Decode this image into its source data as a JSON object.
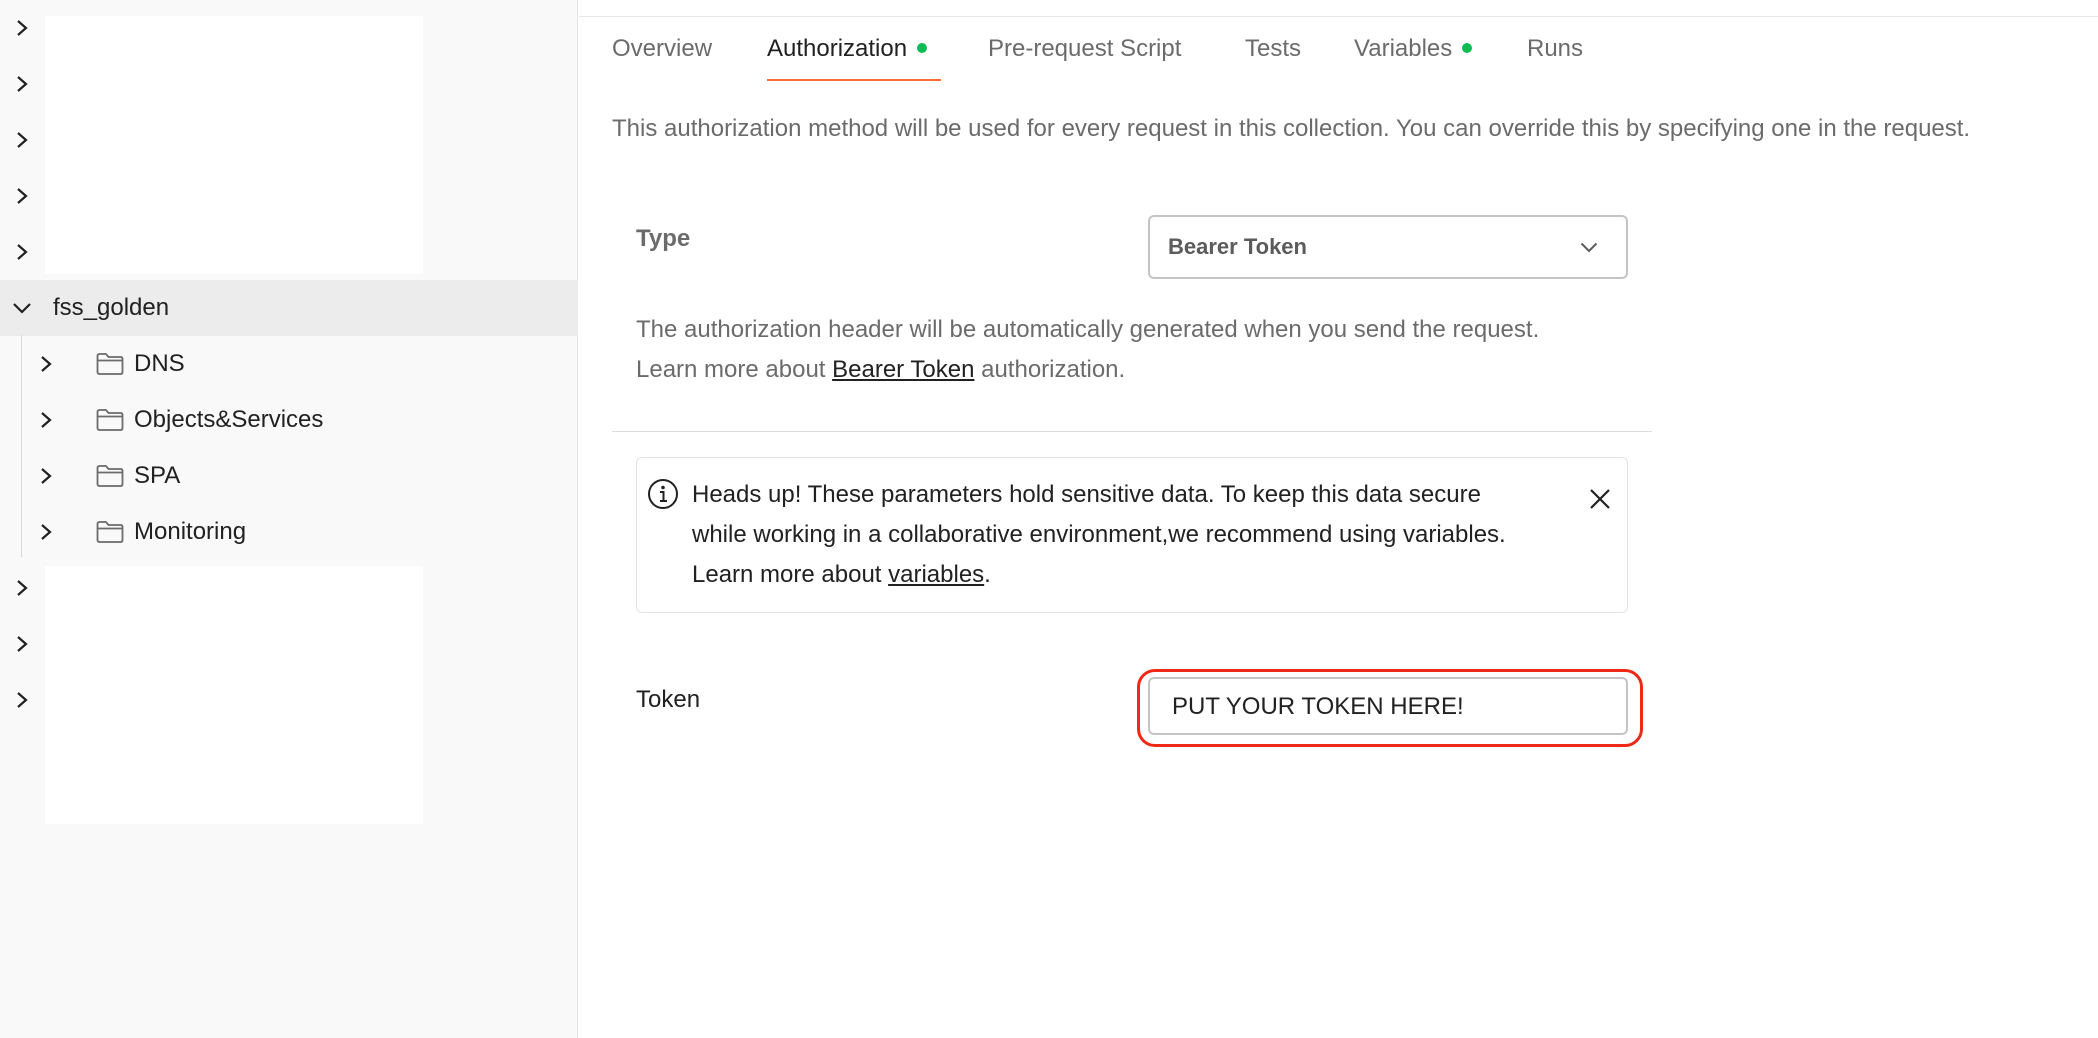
{
  "sidebar": {
    "collection_name": "fss_golden",
    "folders": [
      {
        "label": "DNS"
      },
      {
        "label": "Objects&Services"
      },
      {
        "label": "SPA"
      },
      {
        "label": "Monitoring"
      }
    ]
  },
  "tabs": [
    {
      "label": "Overview",
      "active": false,
      "has_dot": false
    },
    {
      "label": "Authorization",
      "active": true,
      "has_dot": true
    },
    {
      "label": "Pre-request Script",
      "active": false,
      "has_dot": false
    },
    {
      "label": "Tests",
      "active": false,
      "has_dot": false
    },
    {
      "label": "Variables",
      "active": false,
      "has_dot": true
    },
    {
      "label": "Runs",
      "active": false,
      "has_dot": false
    }
  ],
  "colors": {
    "active_tab_underline": "#ff6c37",
    "tab_dot": "#0cbb52",
    "highlight": "#ee2a17"
  },
  "auth": {
    "description": "This authorization method will be used for every request in this collection. You can override this by specifying one in the request.",
    "type_label": "Type",
    "type_value": "Bearer Token",
    "help_line1": "The authorization header will be automatically generated when you send the request.",
    "help_line2_prefix": "Learn more about ",
    "help_link": "Bearer Token",
    "help_line2_suffix": " authorization.",
    "alert": {
      "line1": "Heads up! These parameters hold sensitive data. To keep this data secure",
      "line2": "while working in a collaborative environment,we recommend using variables.",
      "line3_prefix": "Learn more about ",
      "link": "variables",
      "line3_suffix": "."
    },
    "token_label": "Token",
    "token_value": "PUT YOUR TOKEN HERE!"
  }
}
